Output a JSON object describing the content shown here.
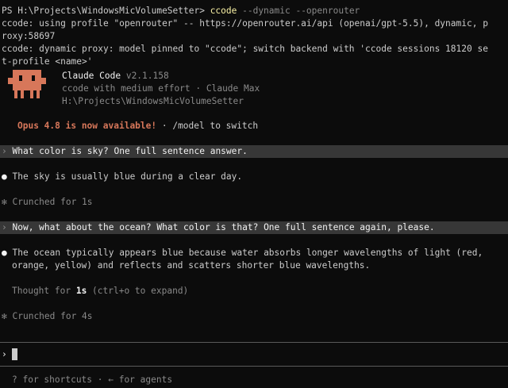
{
  "shell": {
    "prompt": "PS H:\\Projects\\WindowsMicVolumeSetter> ",
    "command": "ccode",
    "args": " --dynamic --openrouter"
  },
  "output": {
    "line1": "ccode: using profile \"openrouter\" -- https://openrouter.ai/api (openai/gpt-5.5), dynamic, p",
    "line2": "roxy:58697",
    "line3": "ccode: dynamic proxy: model pinned to \"ccode\"; switch backend with 'ccode sessions 18120 se",
    "line4": "t-profile <name>'"
  },
  "header": {
    "app_name": "Claude Code",
    "version": " v2.1.158",
    "model_line": "ccode with medium effort · Claude Max",
    "path": "H:\\Projects\\WindowsMicVolumeSetter"
  },
  "notice": {
    "highlight": "Opus 4.8 is now available!",
    "rest": " · /model to switch"
  },
  "conversation": {
    "prompt_glyph": "›",
    "bullet_glyph": "●",
    "spinner_glyph": "✻",
    "q1": "What color is sky? One full sentence answer.",
    "a1": "The sky is usually blue during a clear day.",
    "status1": "Crunched for 1s",
    "q2": "Now, what about the ocean? What color is that? One full sentence again, please.",
    "a2_line1": "The ocean typically appears blue because water absorbs longer wavelengths of light (red,",
    "a2_line2": "orange, yellow) and reflects and scatters shorter blue wavelengths.",
    "thought_prefix": "Thought for ",
    "thought_time": "1s",
    "thought_suffix": " (ctrl+o to expand)",
    "status2": "Crunched for 4s"
  },
  "input": {
    "prompt_glyph": "›",
    "value": ""
  },
  "footer": {
    "hint": "? for shortcuts · ← for agents"
  },
  "colors": {
    "background": "#0c0c0c",
    "text": "#cccccc",
    "accent_orange": "#d7775a",
    "command_yellow": "#f9f1a5",
    "highlight_bar": "#373737",
    "mascot": "#d7775a"
  }
}
